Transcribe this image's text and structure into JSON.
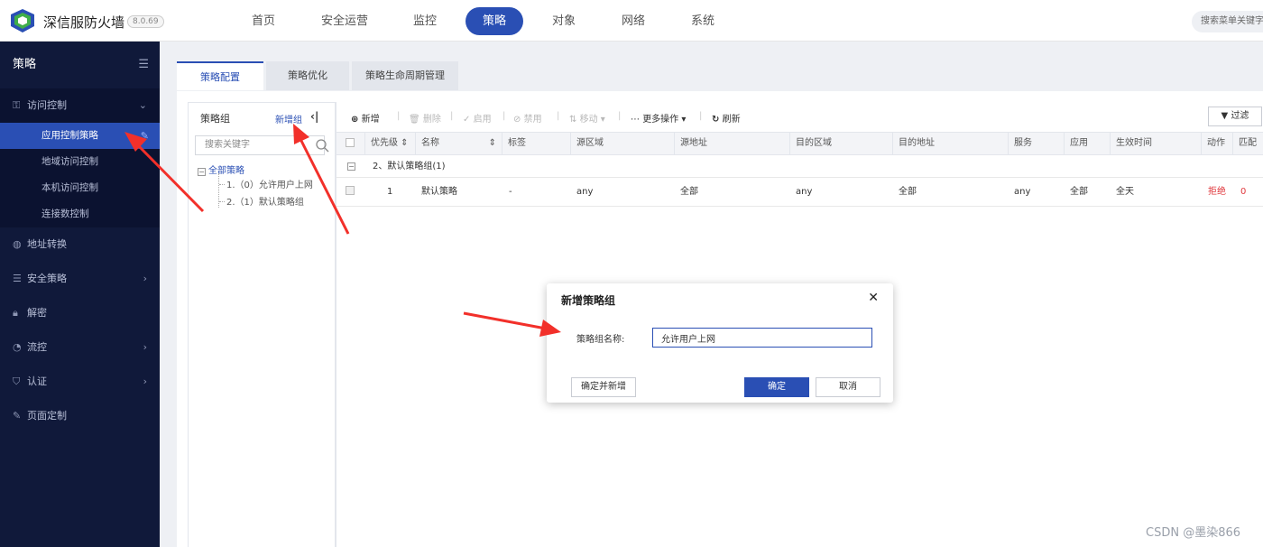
{
  "app": {
    "brand": "深信服防火墙",
    "version": "8.0.69"
  },
  "topnav": {
    "items": [
      "首页",
      "安全运营",
      "监控",
      "策略",
      "对象",
      "网络",
      "系统"
    ],
    "active": "策略",
    "search_placeholder": "搜索菜单关键字"
  },
  "sidebar": {
    "title": "策略",
    "groups": [
      {
        "label": "访问控制",
        "icon": "access-control-icon"
      },
      {
        "label": "地址转换",
        "icon": "globe-icon"
      },
      {
        "label": "安全策略",
        "icon": "list-icon"
      },
      {
        "label": "解密",
        "icon": "lock-icon"
      },
      {
        "label": "流控",
        "icon": "flow-icon"
      },
      {
        "label": "认证",
        "icon": "shield-icon"
      },
      {
        "label": "页面定制",
        "icon": "edit-icon"
      }
    ],
    "subitems": [
      "应用控制策略",
      "地域访问控制",
      "本机访问控制",
      "连接数控制"
    ]
  },
  "tabs": [
    "策略配置",
    "策略优化",
    "策略生命周期管理"
  ],
  "tree": {
    "title": "策略组",
    "add_label": "新增组",
    "search_placeholder": "搜索关键字",
    "root": "全部策略",
    "nodes": [
      "1.（0）允许用户上网",
      "2.（1）默认策略组"
    ]
  },
  "toolbar": {
    "add": "新增",
    "delete": "删除",
    "enable": "启用",
    "disable": "禁用",
    "move": "移动",
    "more": "更多操作",
    "refresh": "刷新",
    "filter": "过滤"
  },
  "table": {
    "headers": [
      "优先级",
      "名称",
      "标签",
      "源区域",
      "源地址",
      "目的区域",
      "目的地址",
      "服务",
      "应用",
      "生效时间",
      "动作",
      "匹配"
    ],
    "group_row": "2、默认策略组(1)",
    "rows": [
      {
        "priority": "1",
        "name": "默认策略",
        "tag": "-",
        "src_zone": "any",
        "src_addr": "全部",
        "dst_zone": "any",
        "dst_addr": "全部",
        "service": "any",
        "app": "全部",
        "time": "全天",
        "action": "拒绝",
        "match": "0"
      }
    ]
  },
  "modal": {
    "title": "新增策略组",
    "label": "策略组名称:",
    "value": "允许用户上网",
    "confirm_add": "确定并新增",
    "ok": "确定",
    "cancel": "取消"
  },
  "colors": {
    "primary": "#2a4fb4",
    "sidebar_bg": "#10193a",
    "deny_red": "#e0393e",
    "arrow_red": "#f2302a"
  },
  "watermark": "CSDN @墨染866"
}
